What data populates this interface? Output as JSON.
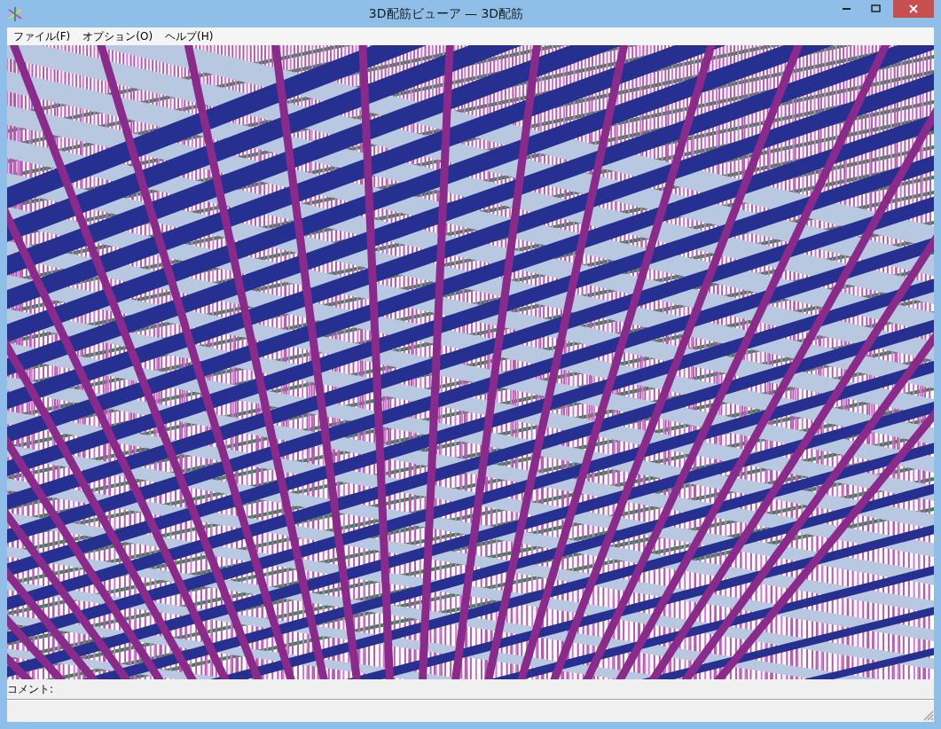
{
  "window": {
    "title": "3D配筋ビューア — 3D配筋"
  },
  "menu": [
    "ファイル(F)",
    "オプション(O)",
    "ヘルプ(H)"
  ],
  "comment": {
    "label": "コメント:"
  }
}
